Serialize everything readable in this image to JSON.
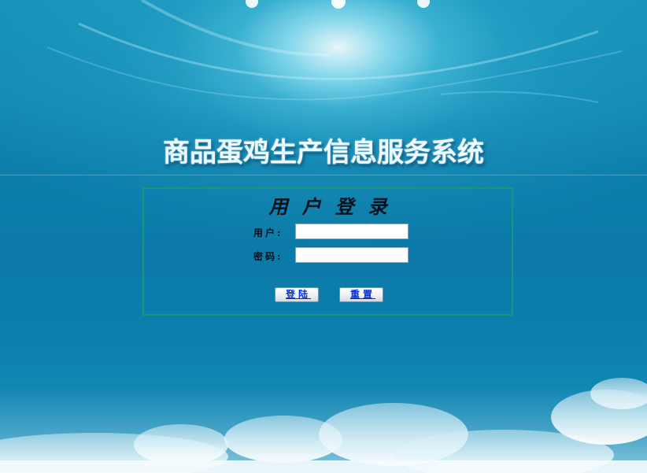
{
  "page": {
    "title": "商品蛋鸡生产信息服务系统"
  },
  "login": {
    "heading": "用户登录",
    "username_label": "用户:",
    "username_value": "",
    "password_label": "密码:",
    "password_value": "",
    "login_button": "登陆",
    "reset_button": "重置"
  },
  "colors": {
    "panel_border": "#19977b",
    "background": "#0c7aa8",
    "button_text": "#0a2fd0"
  }
}
